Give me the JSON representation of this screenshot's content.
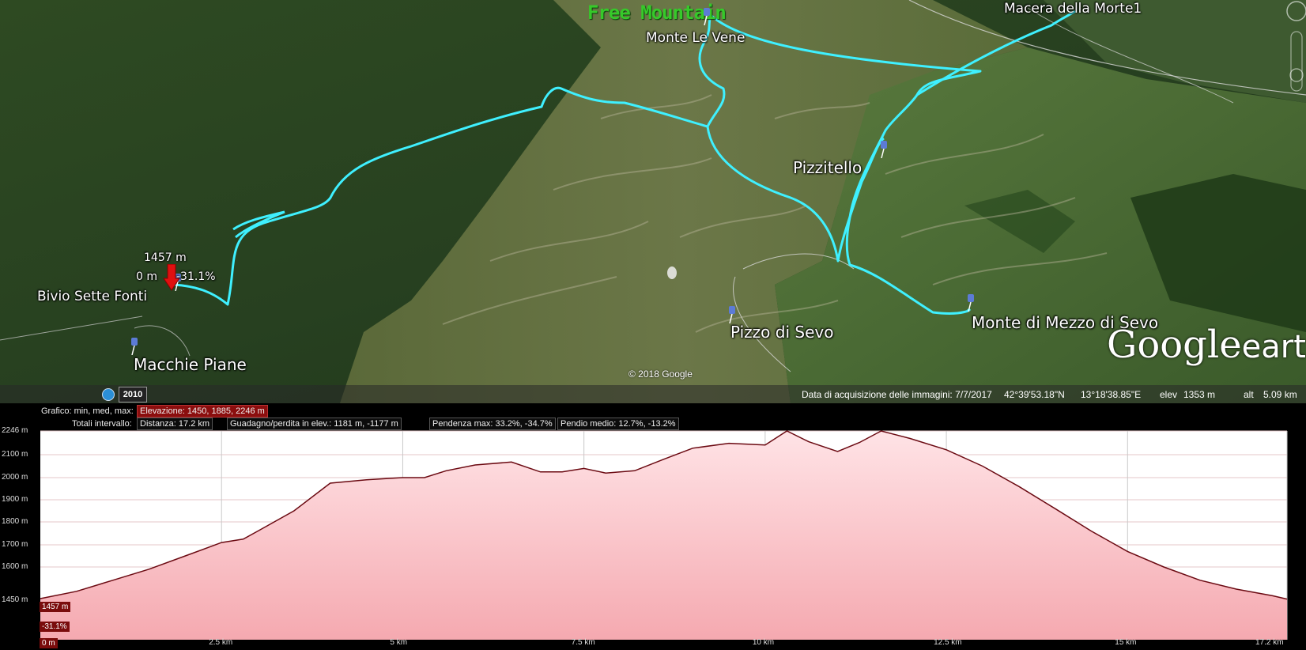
{
  "brand": {
    "text": "Free Mountain"
  },
  "map": {
    "labels": {
      "macera": "Macera della Morte1",
      "monte_le_vene": "Monte Le Vene",
      "pizzitello": "Pizzitello",
      "bivio": "Bivio Sette Fonti",
      "macchie": "Macchie Piane",
      "pizzo_sevo": "Pizzo di Sevo",
      "monte_mezzo": "Monte di Mezzo di Sevo"
    },
    "cursor": {
      "elevation": "1457 m",
      "distance": "0 m",
      "slope": "-31.1%"
    },
    "copyright": "© 2018 Google",
    "logo_main": "Google",
    "logo_sub": "earth",
    "year": "2010"
  },
  "status_bar": {
    "acquisition": "Data di acquisizione delle immagini: 7/7/2017",
    "lat": "42°39'53.18\"N",
    "lon": "13°18'38.85\"E",
    "elev_label": "elev",
    "elev_value": "1353 m",
    "alt_label": "alt",
    "alt_value": "5.09 km"
  },
  "profile": {
    "graph_label": "Grafico: min, med, max:",
    "elevation_box": "Elevazione: 1450, 1885, 2246 m",
    "totals_label": "Totali intervallo:",
    "distance_box": "Distanza: 17.2 km",
    "gain_box": "Guadagno/perdita in elev.: 1181 m, -1177 m",
    "slope_max_box": "Pendenza max: 33.2%, -34.7%",
    "slope_avg_box": "Pendio medio: 12.7%, -13.2%",
    "cursor_elev": "1457 m",
    "cursor_slope": "-31.1%",
    "cursor_dist": "0 m"
  },
  "chart_data": {
    "type": "area",
    "title": "",
    "xlabel": "",
    "ylabel": "",
    "x_unit": "km",
    "y_unit": "m",
    "xlim": [
      0,
      17.2
    ],
    "ylim": [
      1400,
      2246
    ],
    "y_ticks": [
      {
        "value": 2246,
        "label": "2246 m"
      },
      {
        "value": 2100,
        "label": "2100 m"
      },
      {
        "value": 2000,
        "label": "2000 m"
      },
      {
        "value": 1900,
        "label": "1900 m"
      },
      {
        "value": 1800,
        "label": "1800 m"
      },
      {
        "value": 1700,
        "label": "1700 m"
      },
      {
        "value": 1600,
        "label": "1600 m"
      },
      {
        "value": 1450,
        "label": "1450 m"
      }
    ],
    "x_ticks": [
      {
        "value": 2.5,
        "label": "2.5 km"
      },
      {
        "value": 5,
        "label": "5 km"
      },
      {
        "value": 7.5,
        "label": "7.5 km"
      },
      {
        "value": 10,
        "label": "10 km"
      },
      {
        "value": 12.5,
        "label": "12.5 km"
      },
      {
        "value": 15,
        "label": "15 km"
      },
      {
        "value": 17.2,
        "label": "17.2 km"
      }
    ],
    "x": [
      0,
      0.5,
      1.0,
      1.5,
      2.0,
      2.5,
      2.8,
      3.0,
      3.5,
      4.0,
      4.5,
      5.0,
      5.3,
      5.6,
      6.0,
      6.5,
      6.9,
      7.2,
      7.5,
      7.8,
      8.2,
      8.6,
      9.0,
      9.5,
      10.0,
      10.3,
      10.6,
      11.0,
      11.3,
      11.6,
      12.0,
      12.5,
      13.0,
      13.5,
      14.0,
      14.5,
      15.0,
      15.5,
      16.0,
      16.5,
      17.0,
      17.2
    ],
    "series": [
      {
        "values": [
          1457,
          1490,
          1540,
          1590,
          1650,
          1710,
          1725,
          1760,
          1850,
          1975,
          1990,
          2000,
          2000,
          2030,
          2055,
          2068,
          2025,
          2025,
          2040,
          2020,
          2030,
          2080,
          2140,
          2170,
          2160,
          2246,
          2180,
          2120,
          2175,
          2246,
          2200,
          2130,
          2050,
          1960,
          1860,
          1760,
          1670,
          1600,
          1540,
          1500,
          1470,
          1455
        ]
      }
    ],
    "colors": {
      "fill_top": "#ffe3e6",
      "fill_bottom": "#f5a9b0",
      "line": "#6b0a12",
      "grid": "#c8c8c8"
    }
  }
}
